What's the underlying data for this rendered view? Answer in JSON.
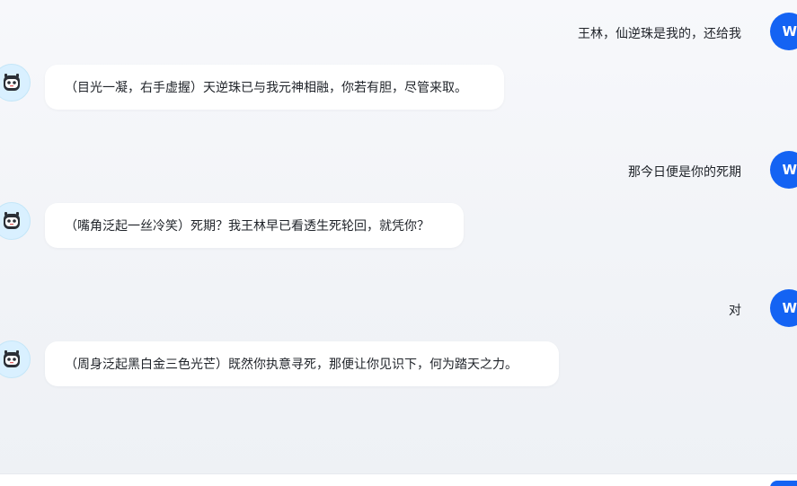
{
  "user": {
    "avatar_letter": "W"
  },
  "messages": [
    {
      "role": "user",
      "text": "王林，仙逆珠是我的，还给我"
    },
    {
      "role": "assistant",
      "text": "（目光一凝，右手虚握）天逆珠已与我元神相融，你若有胆，尽管来取。"
    },
    {
      "role": "user",
      "text": "那今日便是你的死期"
    },
    {
      "role": "assistant",
      "text": "（嘴角泛起一丝冷笑）死期？我王林早已看透生死轮回，就凭你？"
    },
    {
      "role": "user",
      "text": "对"
    },
    {
      "role": "assistant",
      "text": "（周身泛起黑白金三色光芒）既然你执意寻死，那便让你见识下，何为踏天之力。"
    }
  ],
  "colors": {
    "accent": "#1463f3",
    "bot_avatar_bg": "#d9f0ff",
    "bubble_bg": "#ffffff"
  },
  "icons": {
    "bot_avatar": "robot-face-icon",
    "user_avatar": "user-initial-avatar"
  }
}
